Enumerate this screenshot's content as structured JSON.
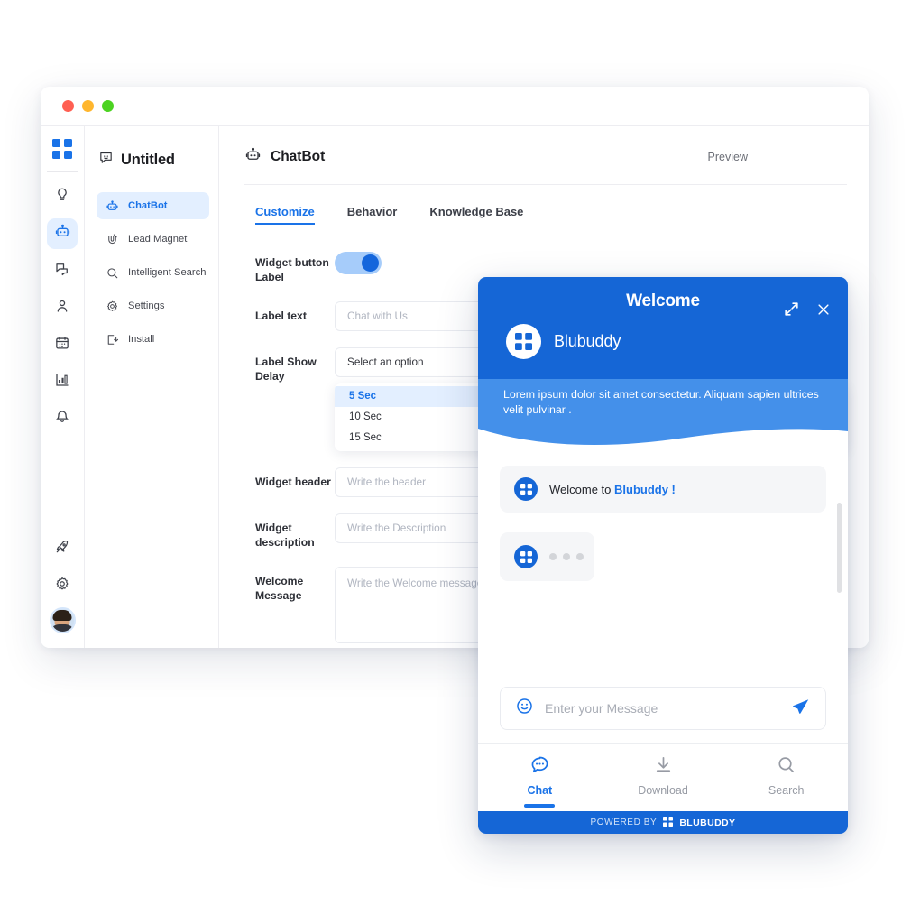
{
  "window": {
    "traffic_lights": [
      {
        "name": "close",
        "color": "#ff5f52"
      },
      {
        "name": "minimize",
        "color": "#ffb62e"
      },
      {
        "name": "maximize",
        "color": "#4cd321"
      }
    ]
  },
  "rail": {
    "logo_icon": "grid-logo-icon",
    "items": [
      {
        "icon": "lightbulb-icon",
        "name": "ideas",
        "active": false
      },
      {
        "icon": "robot-icon",
        "name": "chatbot",
        "active": true
      },
      {
        "icon": "chat-bubbles-icon",
        "name": "conversations",
        "active": false
      },
      {
        "icon": "person-icon",
        "name": "contacts",
        "active": false
      },
      {
        "icon": "calendar-icon",
        "name": "calendar",
        "active": false
      },
      {
        "icon": "bar-chart-icon",
        "name": "analytics",
        "active": false
      },
      {
        "icon": "bell-icon",
        "name": "notifications",
        "active": false
      }
    ],
    "bottom_items": [
      {
        "icon": "rocket-icon",
        "name": "launch"
      },
      {
        "icon": "gear-icon",
        "name": "settings"
      }
    ],
    "avatar": "user-avatar"
  },
  "nav": {
    "project_icon": "smiley-chat-icon",
    "project_title": "Untitled",
    "items": [
      {
        "label": "ChatBot",
        "icon": "robot-icon",
        "active": true
      },
      {
        "label": "Lead Magnet",
        "icon": "magnet-icon",
        "active": false
      },
      {
        "label": "Intelligent Search",
        "icon": "search-icon",
        "active": false
      },
      {
        "label": "Settings",
        "icon": "gear-icon",
        "active": false
      },
      {
        "label": "Install",
        "icon": "install-icon",
        "active": false
      }
    ]
  },
  "content": {
    "title": "ChatBot",
    "title_icon": "robot-icon",
    "preview_label": "Preview",
    "tabs": [
      {
        "label": "Customize",
        "active": true
      },
      {
        "label": "Behavior",
        "active": false
      },
      {
        "label": "Knowledge Base",
        "active": false
      }
    ],
    "fields": {
      "widget_button_label": {
        "label": "Widget button Label",
        "toggle_on": true
      },
      "label_text": {
        "label": "Label text",
        "placeholder": "Chat with Us"
      },
      "label_show_delay": {
        "label": "Label Show Delay",
        "value": "Select an option",
        "options": [
          {
            "label": "5 Sec",
            "selected": true
          },
          {
            "label": "10 Sec",
            "selected": false
          },
          {
            "label": "15 Sec",
            "selected": false
          }
        ]
      },
      "widget_header": {
        "label": "Widget header",
        "placeholder": "Write the header"
      },
      "widget_description": {
        "label": "Widget description",
        "placeholder": "Write the Description"
      },
      "welcome_message": {
        "label": "Welcome Message",
        "placeholder": "Write the Welcome message"
      }
    }
  },
  "widget": {
    "title": "Welcome",
    "expand_icon": "expand-icon",
    "close_icon": "close-icon",
    "brand_name": "Blubuddy",
    "brand_logo_icon": "grid-logo-icon",
    "subtitle": "Lorem ipsum dolor sit amet consectetur. Aliquam sapien ultrices velit pulvinar .",
    "messages": [
      {
        "type": "text",
        "prefix": "Welcome to ",
        "highlight": "Blubuddy !"
      },
      {
        "type": "typing"
      }
    ],
    "input": {
      "placeholder": "Enter your Message",
      "emoji_icon": "smiley-icon",
      "send_icon": "send-icon"
    },
    "nav": [
      {
        "label": "Chat",
        "icon": "chat-icon",
        "active": true
      },
      {
        "label": "Download",
        "icon": "download-icon",
        "active": false
      },
      {
        "label": "Search",
        "icon": "search-icon",
        "active": false
      }
    ],
    "footer": {
      "powered_by": "POWERED BY",
      "brand": "BLUBUDDY",
      "logo_icon": "grid-logo-icon"
    }
  },
  "colors": {
    "brand_blue": "#1566d6",
    "accent_blue": "#1a73e8",
    "light_blue_band": "#4490ea",
    "highlight_bg": "#e3efff"
  }
}
